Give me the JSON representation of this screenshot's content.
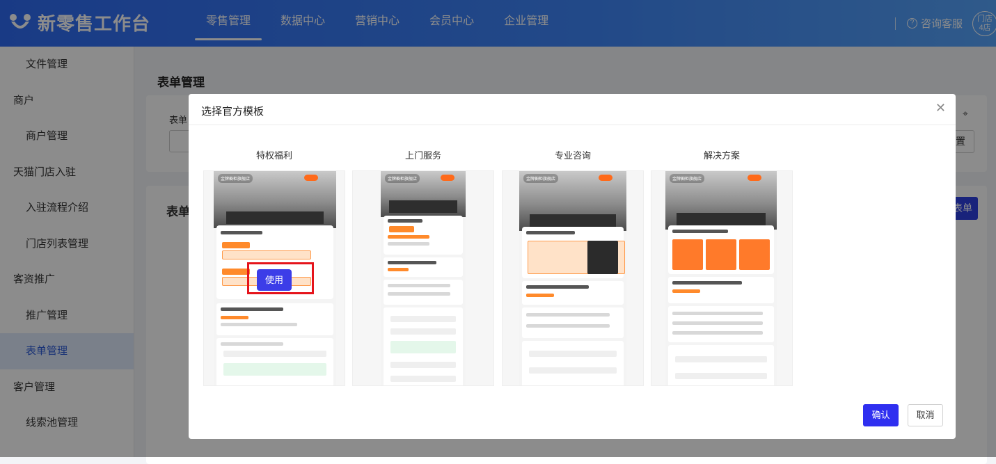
{
  "app": {
    "title": "新零售工作台"
  },
  "nav": [
    {
      "label": "零售管理",
      "active": true
    },
    {
      "label": "数据中心"
    },
    {
      "label": "营销中心"
    },
    {
      "label": "会员中心"
    },
    {
      "label": "企业管理"
    }
  ],
  "header": {
    "consult_label": "咨询客服",
    "store_badge_line1": "门店",
    "store_badge_line2": "4店"
  },
  "sidebar": {
    "items": [
      {
        "label": "文件管理",
        "level": 2
      },
      {
        "label": "商户",
        "level": 1
      },
      {
        "label": "商户管理",
        "level": 2
      },
      {
        "label": "天猫门店入驻",
        "level": 1
      },
      {
        "label": "入驻流程介绍",
        "level": 2
      },
      {
        "label": "门店列表管理",
        "level": 2
      },
      {
        "label": "客资推广",
        "level": 1
      },
      {
        "label": "推广管理",
        "level": 2
      },
      {
        "label": "表单管理",
        "level": 2,
        "active": true
      },
      {
        "label": "客户管理",
        "level": 1
      },
      {
        "label": "线索池管理",
        "level": 2
      }
    ]
  },
  "page": {
    "title": "表单管理",
    "filter_label_partial": "表单",
    "section_label_partial": "表单",
    "reset_partial": "置",
    "create_partial": "表单"
  },
  "modal": {
    "title": "选择官方模板",
    "templates": [
      {
        "name": "特权福利",
        "shop": "金牌橱柜旗舰店"
      },
      {
        "name": "上门服务",
        "shop": "金牌橱柜旗舰店"
      },
      {
        "name": "专业咨询",
        "shop": "金牌橱柜旗舰店"
      },
      {
        "name": "解决方案",
        "shop": "金牌橱柜旗舰店"
      }
    ],
    "use_label": "使用",
    "confirm_label": "确认",
    "cancel_label": "取消"
  },
  "colors": {
    "primary": "#2f2ff0",
    "header": "#3a7bf5",
    "highlight": "#e5141b",
    "accent": "#ff8a2b"
  }
}
